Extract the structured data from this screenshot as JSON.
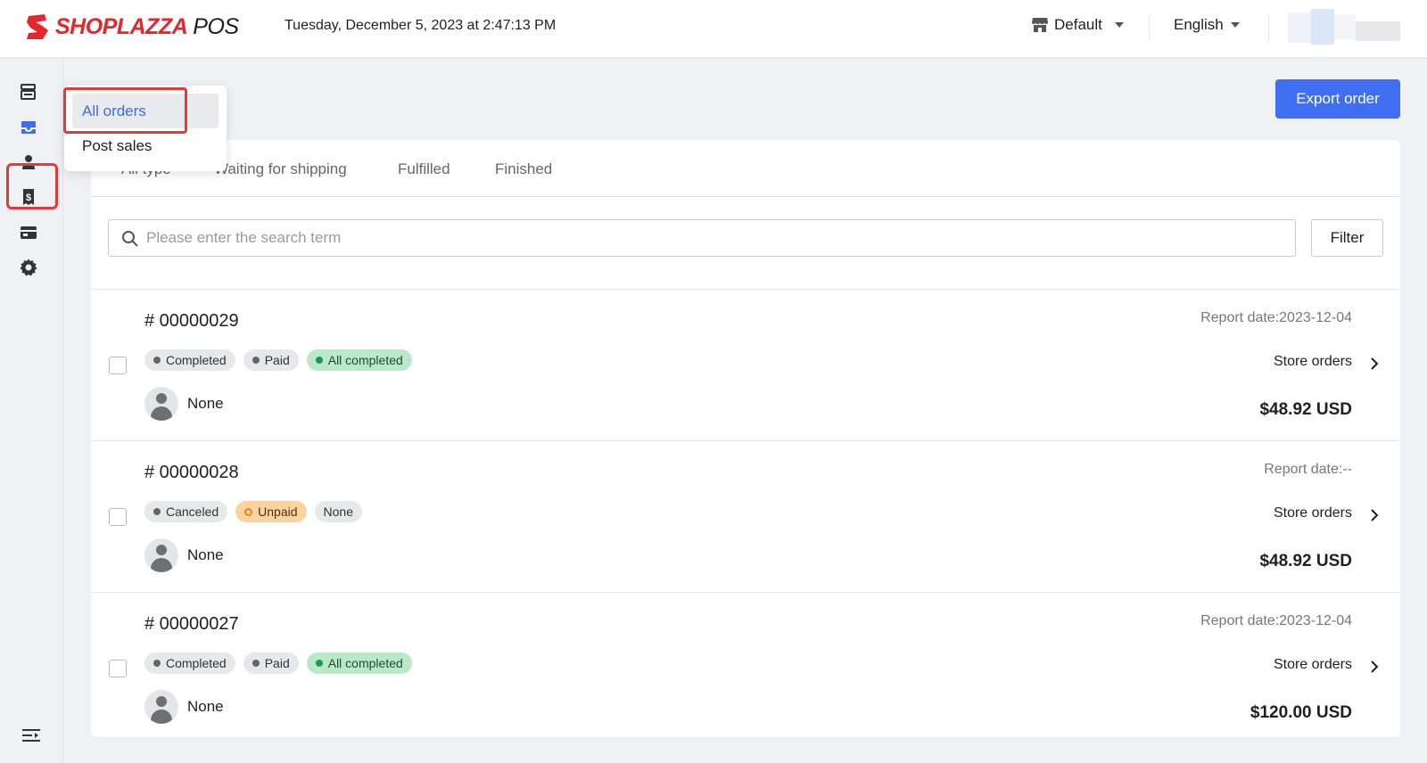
{
  "header": {
    "brand": "SHOPLAZZA",
    "product": "POS",
    "datetime": "Tuesday, December 5, 2023 at 2:47:13 PM",
    "store_label": "Default",
    "language_label": "English"
  },
  "rail": {
    "items": [
      {
        "icon": "register-icon"
      },
      {
        "icon": "orders-icon",
        "active": true
      },
      {
        "icon": "customer-icon"
      },
      {
        "icon": "receipt-dollar-icon"
      },
      {
        "icon": "store-card-icon"
      },
      {
        "icon": "gear-icon"
      }
    ],
    "collapse_icon": "collapse-menu-icon"
  },
  "orders_menu": {
    "items": [
      {
        "label": "All orders",
        "active": true
      },
      {
        "label": "Post sales",
        "active": false
      }
    ]
  },
  "toolbar": {
    "export_label": "Export order"
  },
  "tabs": [
    {
      "label": "All type"
    },
    {
      "label": "Waiting for shipping"
    },
    {
      "label": "Fulfilled"
    },
    {
      "label": "Finished"
    }
  ],
  "search": {
    "placeholder": "Please enter the search term",
    "value": ""
  },
  "filter_label": "Filter",
  "orders": [
    {
      "number": "# 00000029",
      "report_date": "Report date:2023-12-04",
      "badges": [
        {
          "label": "Completed",
          "style": "gray"
        },
        {
          "label": "Paid",
          "style": "gray"
        },
        {
          "label": "All completed",
          "style": "green"
        }
      ],
      "customer": "None",
      "type": "Store orders",
      "total": "$48.92 USD"
    },
    {
      "number": "# 00000028",
      "report_date": "Report date:--",
      "badges": [
        {
          "label": "Canceled",
          "style": "gray"
        },
        {
          "label": "Unpaid",
          "style": "orange"
        },
        {
          "label": "None",
          "style": "plain"
        }
      ],
      "customer": "None",
      "type": "Store orders",
      "total": "$48.92 USD"
    },
    {
      "number": "# 00000027",
      "report_date": "Report date:2023-12-04",
      "badges": [
        {
          "label": "Completed",
          "style": "gray"
        },
        {
          "label": "Paid",
          "style": "gray"
        },
        {
          "label": "All completed",
          "style": "green"
        }
      ],
      "customer": "None",
      "type": "Store orders",
      "total": "$120.00 USD"
    }
  ],
  "colors": {
    "brand_red": "#e5262a",
    "primary_blue": "#3f6ff0",
    "highlight_red": "#e5383b",
    "badge_green": "#b9e9c9",
    "badge_orange": "#fcd39c"
  }
}
